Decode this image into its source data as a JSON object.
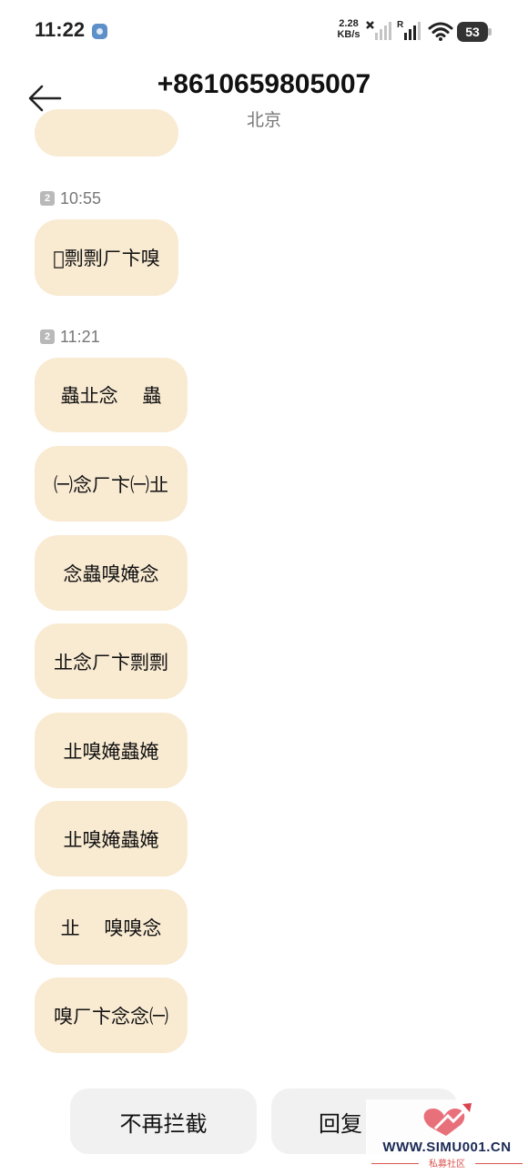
{
  "status_bar": {
    "time": "11:22",
    "net_speed_value": "2.28",
    "net_speed_unit": "KB/s",
    "roaming_label": "R",
    "battery_level": "53",
    "icons": [
      "app-notification-icon",
      "signal-no-service-icon",
      "signal-icon",
      "wifi-icon",
      "battery-icon"
    ]
  },
  "header": {
    "title": "+8610659805007",
    "subtitle": "北京",
    "back_icon": "arrow-left-icon"
  },
  "messages": [
    {
      "sim": "2",
      "time": "10:55",
      "bubbles": [
        "􀀀剽剽ㄏ卞嗅"
      ]
    },
    {
      "sim": "2",
      "time": "11:21",
      "bubbles": [
        "蟲㐀念    蟲",
        "㈠念ㄏ卞㈠㐀",
        "念蟲嗅㛪念",
        "㐀念ㄏ卞剽剽",
        "㐀嗅㛪蟲㛪",
        "㐀嗅㛪蟲㛪",
        "㐀    嗅嗅念",
        "嗅ㄏ卞念念㈠"
      ]
    }
  ],
  "actions": {
    "unblock_label": "不再拦截",
    "reply_label": "回复"
  },
  "watermark": {
    "url": "WWW.SIMU001.CN",
    "sub": "私募社区"
  },
  "colors": {
    "bubble": "#f9ead2",
    "button": "#f1f1f1",
    "timestamp": "#777777"
  }
}
